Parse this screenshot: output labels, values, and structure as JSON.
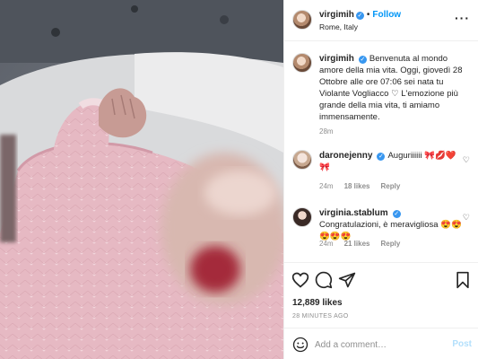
{
  "post": {
    "username": "virgimih",
    "follow_label": "Follow",
    "separator": "•",
    "location": "Rome, Italy",
    "more_label": "···"
  },
  "caption": {
    "username": "virgimih",
    "text": "Benvenuta al mondo amore della mia vita. Oggi, giovedì 28 Ottobre alle ore 07:06 sei nata tu Violante Vogliacco ♡ L'emozione più grande della mia vita, ti amiamo immensamente.",
    "time": "28m"
  },
  "comments": [
    {
      "username": "daronejenny",
      "text": "Auguriiiiii",
      "emoji": "🎀💋❤️🎀",
      "time": "24m",
      "likes": "18 likes",
      "reply": "Reply"
    },
    {
      "username": "virginia.stablum",
      "text": "Congratulazioni, è meravigliosa",
      "emoji": "😍😍😍😍😍",
      "time": "24m",
      "likes": "21 likes",
      "reply": "Reply"
    }
  ],
  "footer": {
    "likes": "12,889 likes",
    "timestamp": "28 MINUTES AGO",
    "comment_placeholder": "Add a comment…",
    "post_label": "Post"
  },
  "icons": {
    "verified": "verified-badge-icon",
    "like": "heart-icon",
    "comment": "comment-icon",
    "share": "paper-plane-icon",
    "save": "bookmark-icon",
    "emoji": "smiley-icon"
  },
  "colors": {
    "link_blue": "#0095f6",
    "verified_blue": "#3897f0",
    "secondary_text": "#8e8e8e",
    "post_disabled": "#b2dffc"
  }
}
